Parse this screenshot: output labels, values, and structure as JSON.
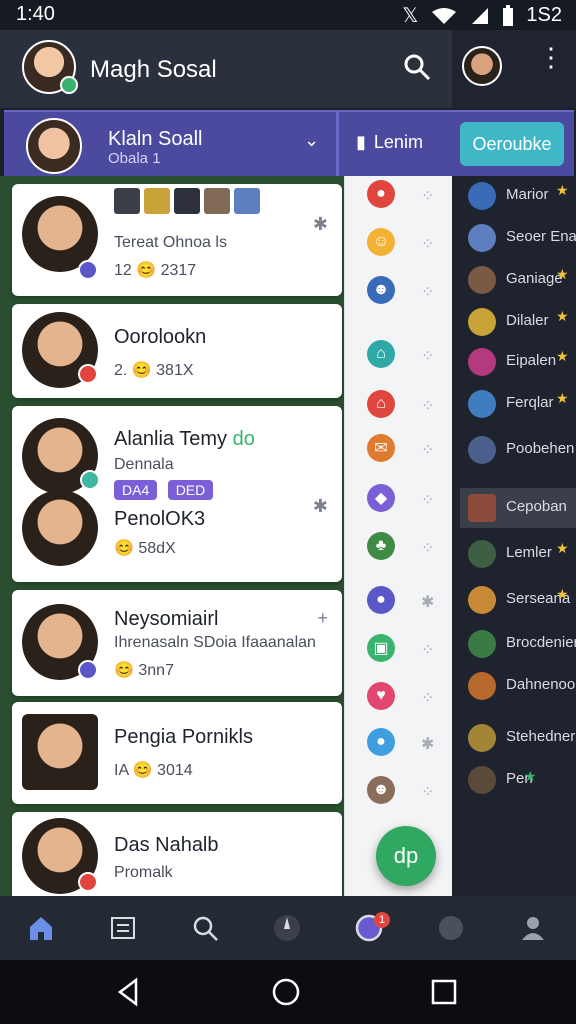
{
  "status_bar": {
    "time": "1:40",
    "clock_right": "1S2"
  },
  "header": {
    "title": "Magh Sosal"
  },
  "account": {
    "name": "Klaln Soall",
    "subtitle": "Obala 1",
    "button_label": "Lenim",
    "cta_label": "Oeroubke"
  },
  "feed": {
    "cards": [
      {
        "name": "",
        "line1": "Tereat Ohnoa ls",
        "stat": "12 😊 2317"
      },
      {
        "name": "Oorolookn",
        "line1": "",
        "stat": "2. 😊 381X"
      },
      {
        "name": "Alanlia Temy",
        "name_suffix": "do",
        "line1": "Dennala",
        "tags": [
          "DA4",
          "DED"
        ],
        "line2": "PenolOK3",
        "stat": "😊 58dX"
      },
      {
        "name": "Neysomiairl",
        "line1": "Ihrenasaln SDoia Ifaaanalan",
        "stat": "😊 3nn7"
      },
      {
        "name": "Pengia Pornikls",
        "line1": "",
        "stat": "IA 😊 3014"
      },
      {
        "name": "Das Nahalb",
        "line1": "Promalk",
        "stat": ""
      }
    ]
  },
  "right_panel": {
    "items": [
      {
        "label": "Marior",
        "star": true
      },
      {
        "label": "Seoer Enaer",
        "star": false
      },
      {
        "label": "Ganiage",
        "star": true
      },
      {
        "label": "Dilaler",
        "star": true
      },
      {
        "label": "Eipalen",
        "star": true
      },
      {
        "label": "Ferqlar",
        "star": true
      },
      {
        "label": "Poobehen",
        "star": false
      },
      {
        "label": "Cepoban",
        "star": false,
        "selected": true
      },
      {
        "label": "Lemler",
        "star": true
      },
      {
        "label": "Serseana",
        "star": true
      },
      {
        "label": "Brocdenier",
        "star": false
      },
      {
        "label": "Dahnenoor",
        "star": false
      },
      {
        "label": "Stehedner",
        "star": false
      },
      {
        "label": "Pen",
        "star": true
      }
    ]
  },
  "fab": {
    "label": "dp"
  },
  "bottom_nav": {
    "badge_count": "1"
  }
}
